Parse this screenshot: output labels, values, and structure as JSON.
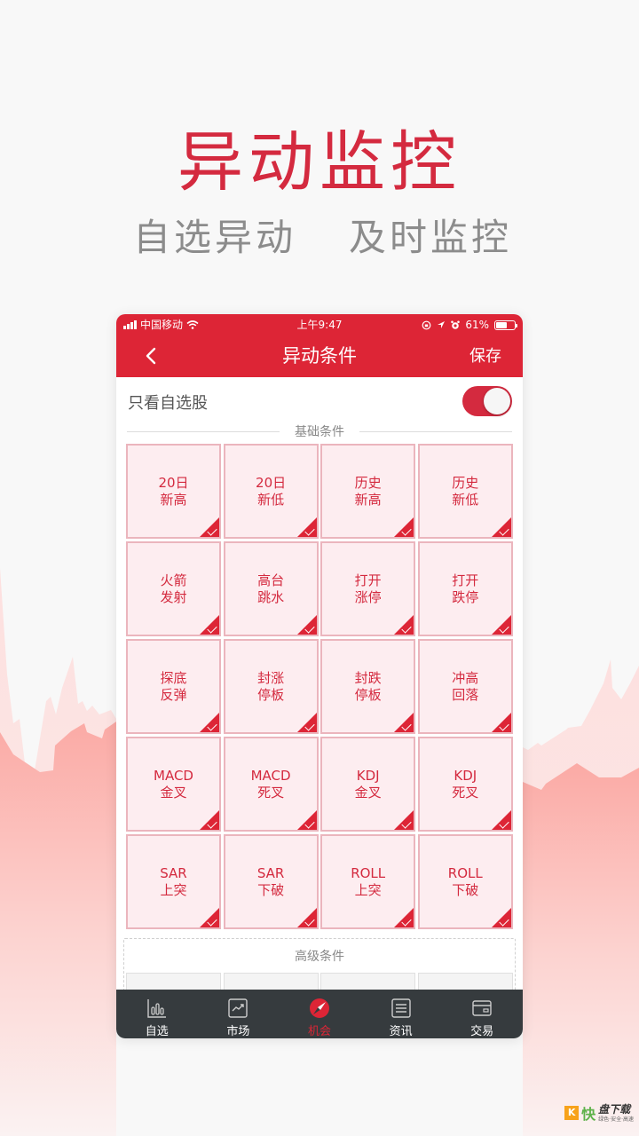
{
  "hero": {
    "title": "异动监控",
    "subtitle_left": "自选异动",
    "subtitle_right": "及时监控"
  },
  "statusbar": {
    "carrier": "中国移动",
    "time": "上午9:47",
    "battery": "61%",
    "battery_level": 0.61
  },
  "navbar": {
    "back_icon": "chevron-left-icon",
    "title": "异动条件",
    "save_label": "保存"
  },
  "filter": {
    "label": "只看自选股",
    "toggle_on": true
  },
  "basic_section": {
    "label": "基础条件",
    "tiles": [
      {
        "line1": "20日",
        "line2": "新高",
        "checked": true
      },
      {
        "line1": "20日",
        "line2": "新低",
        "checked": true
      },
      {
        "line1": "历史",
        "line2": "新高",
        "checked": true
      },
      {
        "line1": "历史",
        "line2": "新低",
        "checked": true
      },
      {
        "line1": "火箭",
        "line2": "发射",
        "checked": true
      },
      {
        "line1": "高台",
        "line2": "跳水",
        "checked": true
      },
      {
        "line1": "打开",
        "line2": "涨停",
        "checked": true
      },
      {
        "line1": "打开",
        "line2": "跌停",
        "checked": true
      },
      {
        "line1": "探底",
        "line2": "反弹",
        "checked": true
      },
      {
        "line1": "封涨",
        "line2": "停板",
        "checked": true
      },
      {
        "line1": "封跌",
        "line2": "停板",
        "checked": true
      },
      {
        "line1": "冲高",
        "line2": "回落",
        "checked": true
      },
      {
        "line1": "MACD",
        "line2": "金叉",
        "checked": true
      },
      {
        "line1": "MACD",
        "line2": "死叉",
        "checked": true
      },
      {
        "line1": "KDJ",
        "line2": "金叉",
        "checked": true
      },
      {
        "line1": "KDJ",
        "line2": "死叉",
        "checked": true
      },
      {
        "line1": "SAR",
        "line2": "上突",
        "checked": true
      },
      {
        "line1": "SAR",
        "line2": "下破",
        "checked": true
      },
      {
        "line1": "ROLL",
        "line2": "上突",
        "checked": true
      },
      {
        "line1": "ROLL",
        "line2": "下破",
        "checked": true
      }
    ]
  },
  "advanced_section": {
    "label": "高级条件"
  },
  "tabbar": {
    "items": [
      {
        "label": "自选",
        "icon": "bar-chart-icon",
        "active": false
      },
      {
        "label": "市场",
        "icon": "trend-chart-icon",
        "active": false
      },
      {
        "label": "机会",
        "icon": "compass-icon",
        "active": true
      },
      {
        "label": "资讯",
        "icon": "news-icon",
        "active": false
      },
      {
        "label": "交易",
        "icon": "wallet-icon",
        "active": false
      }
    ]
  },
  "colors": {
    "brand_red": "#dd2536",
    "tile_bg": "#fdedf0",
    "tile_border": "#ebb5bd",
    "tabbar_bg": "#363b3e"
  },
  "watermark": {
    "k": "K",
    "kuai": "快",
    "name": "盘下载",
    "tagline": "绿色·安全·高速"
  }
}
